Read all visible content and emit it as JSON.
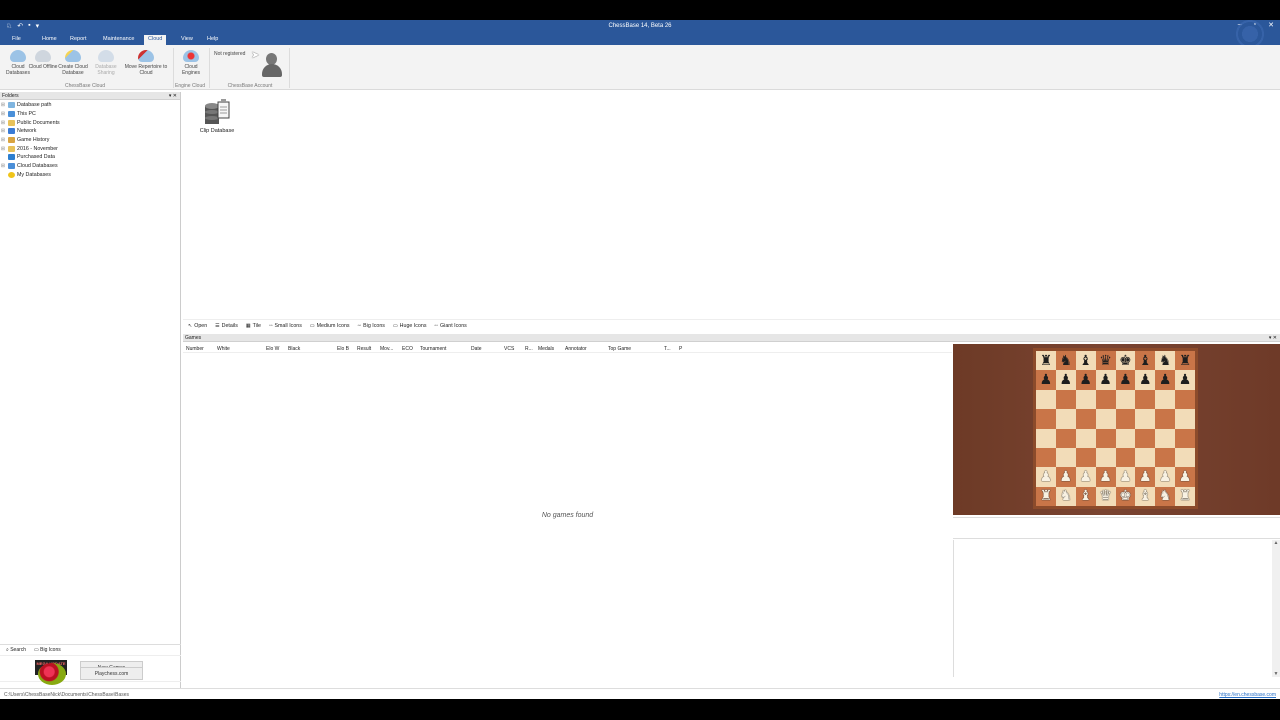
{
  "window": {
    "title": "ChessBase 14, Beta 26",
    "controls": [
      "–",
      "▫",
      "✕"
    ]
  },
  "menu": {
    "tabs": [
      "File",
      "Home",
      "Report",
      "Maintenance",
      "Cloud",
      "View",
      "Help"
    ],
    "active": "Cloud"
  },
  "ribbon": {
    "buttons": [
      {
        "label": "Cloud Databases",
        "icon": "cloud-icon",
        "enabled": true
      },
      {
        "label": "Cloud Offline",
        "icon": "cloud-offline-icon",
        "enabled": true
      },
      {
        "label": "Create Cloud Database",
        "icon": "cloud-create-icon",
        "enabled": true
      },
      {
        "label": "Database Sharing",
        "icon": "cloud-share-icon",
        "enabled": false
      },
      {
        "label": "Move Repertoire to Cloud",
        "icon": "move-repertoire-icon",
        "enabled": true
      },
      {
        "label": "Cloud Engines",
        "icon": "cloud-engine-icon",
        "enabled": true
      }
    ],
    "groups": [
      "ChessBase Cloud",
      "Engine Cloud",
      "ChessBase Account"
    ],
    "account_status": "Not registered"
  },
  "folders": {
    "title": "Folders",
    "items": [
      {
        "label": "Database path",
        "expandable": true
      },
      {
        "label": "This PC",
        "expandable": true
      },
      {
        "label": "Public Documents",
        "expandable": true
      },
      {
        "label": "Network",
        "expandable": true
      },
      {
        "label": "Game History",
        "expandable": true
      },
      {
        "label": "2016 - November",
        "expandable": true
      },
      {
        "label": "Purchased Data",
        "expandable": false
      },
      {
        "label": "Cloud Databases",
        "expandable": true
      },
      {
        "label": "My Databases",
        "expandable": false
      }
    ],
    "search_label": "Search",
    "bigicons_label": "Big Icons",
    "mega_update_logo": "MEGA UPDATE",
    "new_games_button": "New Games",
    "playchess_button": "Playchess.com"
  },
  "databases": [
    {
      "label": "Clip Database"
    }
  ],
  "view_modes": [
    "Open",
    "Details",
    "Tile",
    "Small Icons",
    "Medium Icons",
    "Big Icons",
    "Huge Icons",
    "Giant Icons"
  ],
  "games": {
    "title": "Games",
    "columns": [
      "Number",
      "White",
      "Elo W",
      "Black",
      "Elo B",
      "Result",
      "Mov...",
      "ECO",
      "Tournament",
      "Date",
      "VCS",
      "R...",
      "Medals",
      "Annotator",
      "Top Game",
      "T...",
      "P"
    ],
    "empty_text": "No games found"
  },
  "board": {
    "rows": [
      [
        "♜",
        "♞",
        "♝",
        "♛",
        "♚",
        "♝",
        "♞",
        "♜"
      ],
      [
        "♟",
        "♟",
        "♟",
        "♟",
        "♟",
        "♟",
        "♟",
        "♟"
      ],
      [
        "",
        "",
        "",
        "",
        "",
        "",
        "",
        ""
      ],
      [
        "",
        "",
        "",
        "",
        "",
        "",
        "",
        ""
      ],
      [
        "",
        "",
        "",
        "",
        "",
        "",
        "",
        ""
      ],
      [
        "",
        "",
        "",
        "",
        "",
        "",
        "",
        ""
      ],
      [
        "♟",
        "♟",
        "♟",
        "♟",
        "♟",
        "♟",
        "♟",
        "♟"
      ],
      [
        "♜",
        "♞",
        "♝",
        "♛",
        "♚",
        "♝",
        "♞",
        "♜"
      ]
    ],
    "light_square": "#f2dcb8",
    "dark_square": "#c97548"
  },
  "status": {
    "path": "C:\\Users\\ChessBaseNick\\Documents\\ChessBase\\Bases",
    "link": "https://en.chessbase.com"
  },
  "colors": {
    "accent": "#2b579a"
  }
}
